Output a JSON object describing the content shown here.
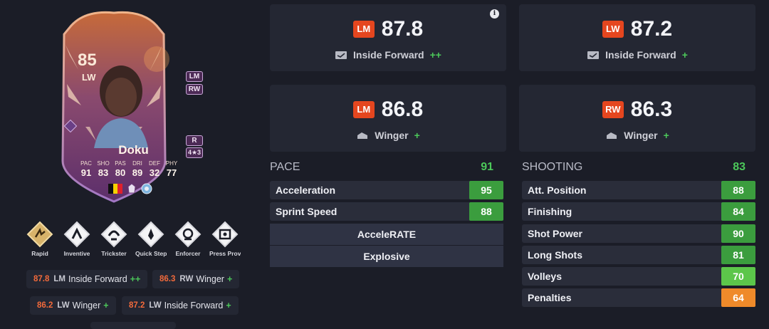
{
  "card": {
    "rating": "85",
    "position": "LW",
    "alt_positions": [
      "LM",
      "RW"
    ],
    "preferred_foot": "R",
    "skill_weak": "4★3",
    "name": "Doku",
    "stats": [
      {
        "label": "PAC",
        "value": "91"
      },
      {
        "label": "SHO",
        "value": "83"
      },
      {
        "label": "PAS",
        "value": "80"
      },
      {
        "label": "DRI",
        "value": "89"
      },
      {
        "label": "DEF",
        "value": "32"
      },
      {
        "label": "PHY",
        "value": "77"
      }
    ],
    "colors": {
      "card_top": "#c66a3a",
      "card_mid": "#8a4a6e",
      "card_bottom": "#5c2f6b",
      "fangs": "#e6c3b2"
    },
    "icons": [
      "belgium-flag-icon",
      "premier-league-icon",
      "manchester-city-badge-icon"
    ]
  },
  "playstyles": [
    {
      "label": "Rapid",
      "icon": "rapid-icon",
      "plus": true
    },
    {
      "label": "Inventive",
      "icon": "inventive-icon",
      "plus": false
    },
    {
      "label": "Trickster",
      "icon": "trickster-icon",
      "plus": false
    },
    {
      "label": "Quick Step",
      "icon": "quick-step-icon",
      "plus": false
    },
    {
      "label": "Enforcer",
      "icon": "enforcer-icon",
      "plus": false
    },
    {
      "label": "Press Proven",
      "icon": "press-proven-icon",
      "plus": false
    }
  ],
  "mini_roles": [
    {
      "num": "87.8",
      "pos": "LM",
      "role": "Inside Forward",
      "plus": "++"
    },
    {
      "num": "86.3",
      "pos": "RW",
      "role": "Winger",
      "plus": "+"
    },
    {
      "num": "86.2",
      "pos": "LW",
      "role": "Winger",
      "plus": "+"
    },
    {
      "num": "87.2",
      "pos": "LW",
      "role": "Inside Forward",
      "plus": "+"
    }
  ],
  "role_boxes": [
    {
      "pos": "LM",
      "score": "87.8",
      "role": "Inside Forward",
      "plus": "++",
      "icon": "inside-forward-icon"
    },
    {
      "pos": "LW",
      "score": "87.2",
      "role": "Inside Forward",
      "plus": "+",
      "icon": "inside-forward-icon"
    },
    {
      "pos": "LM",
      "score": "86.8",
      "role": "Winger",
      "plus": "+",
      "icon": "winger-icon"
    },
    {
      "pos": "RW",
      "score": "86.3",
      "role": "Winger",
      "plus": "+",
      "icon": "winger-icon"
    }
  ],
  "pace": {
    "title": "PACE",
    "total": "91",
    "attributes": [
      {
        "name": "Acceleration",
        "value": "95",
        "color": "#3b9d3e"
      },
      {
        "name": "Sprint Speed",
        "value": "88",
        "color": "#3b9d3e"
      }
    ],
    "traits": [
      "AcceleRATE",
      "Explosive"
    ]
  },
  "shooting": {
    "title": "SHOOTING",
    "total": "83",
    "attributes": [
      {
        "name": "Att. Position",
        "value": "88",
        "color": "#3b9d3e"
      },
      {
        "name": "Finishing",
        "value": "84",
        "color": "#3b9d3e"
      },
      {
        "name": "Shot Power",
        "value": "90",
        "color": "#3b9d3e"
      },
      {
        "name": "Long Shots",
        "value": "81",
        "color": "#3b9d3e"
      },
      {
        "name": "Volleys",
        "value": "70",
        "color": "#5cc64a"
      },
      {
        "name": "Penalties",
        "value": "64",
        "color": "#ef8a2a"
      }
    ]
  }
}
